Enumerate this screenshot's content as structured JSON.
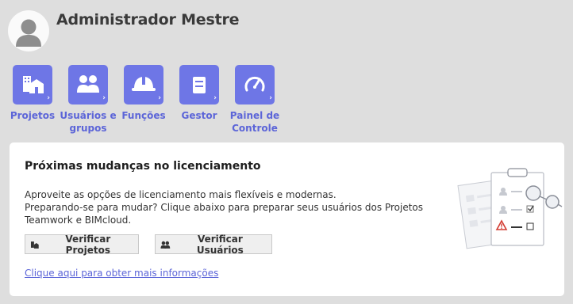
{
  "header": {
    "user_name": "Administrador Mestre",
    "avatar_icon": "user-avatar-icon"
  },
  "nav": {
    "accent_color": "#6e76e6",
    "items": [
      {
        "label": "Projetos",
        "icon": "projects-building-icon"
      },
      {
        "label": "Usuários e grupos",
        "icon": "users-groups-icon"
      },
      {
        "label": "Funções",
        "icon": "hard-hat-icon"
      },
      {
        "label": "Gestor",
        "icon": "server-icon"
      },
      {
        "label": "Painel de Controle",
        "icon": "gauge-icon"
      }
    ]
  },
  "licensing": {
    "title": "Próximas mudanças no licenciamento",
    "line1": "Aproveite as opções de licenciamento mais flexíveis e modernas.",
    "line2": "Preparando-se para mudar? Clique abaixo para preparar seus usuários dos Projetos Teamwork e BIMcloud.",
    "verify_projects_label": "Verificar Projetos",
    "verify_users_label": "Verificar Usuários",
    "more_info_link": "Clique aqui para obter mais informações",
    "illustration_icon": "clipboard-checklist-illustration"
  }
}
